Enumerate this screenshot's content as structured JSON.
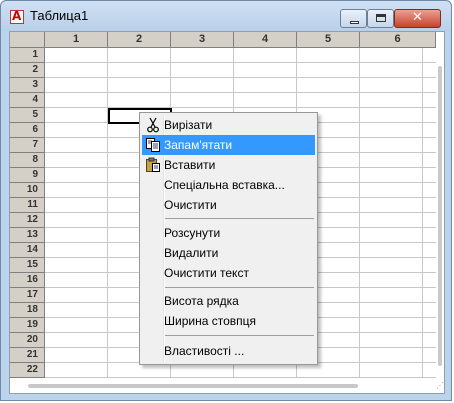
{
  "window": {
    "title": "Таблица1"
  },
  "grid": {
    "columns": [
      "1",
      "2",
      "3",
      "4",
      "5",
      "6"
    ],
    "rows": [
      "1",
      "2",
      "3",
      "4",
      "5",
      "6",
      "7",
      "8",
      "9",
      "10",
      "11",
      "12",
      "13",
      "14",
      "15",
      "16",
      "17",
      "18",
      "19",
      "20",
      "21",
      "22"
    ],
    "active_cell": {
      "row": "5",
      "col": "2"
    }
  },
  "context_menu": {
    "items": [
      {
        "label": "Вирізати",
        "icon": "scissors-icon",
        "highlighted": false
      },
      {
        "label": "Запам'ятати",
        "icon": "copy-icon",
        "highlighted": true
      },
      {
        "label": "Вставити",
        "icon": "paste-icon",
        "highlighted": false
      },
      {
        "label": "Спеціальна вставка...",
        "icon": "",
        "highlighted": false
      },
      {
        "label": "Очистити",
        "icon": "",
        "highlighted": false
      },
      {
        "label": "Розсунути",
        "icon": "",
        "highlighted": false
      },
      {
        "label": "Видалити",
        "icon": "",
        "highlighted": false
      },
      {
        "label": "Очистити текст",
        "icon": "",
        "highlighted": false
      },
      {
        "label": "Висота рядка",
        "icon": "",
        "highlighted": false
      },
      {
        "label": "Ширина стовпця",
        "icon": "",
        "highlighted": false
      },
      {
        "label": "Властивості ...",
        "icon": "",
        "highlighted": false
      }
    ]
  },
  "colors": {
    "highlight": "#3399ff"
  }
}
